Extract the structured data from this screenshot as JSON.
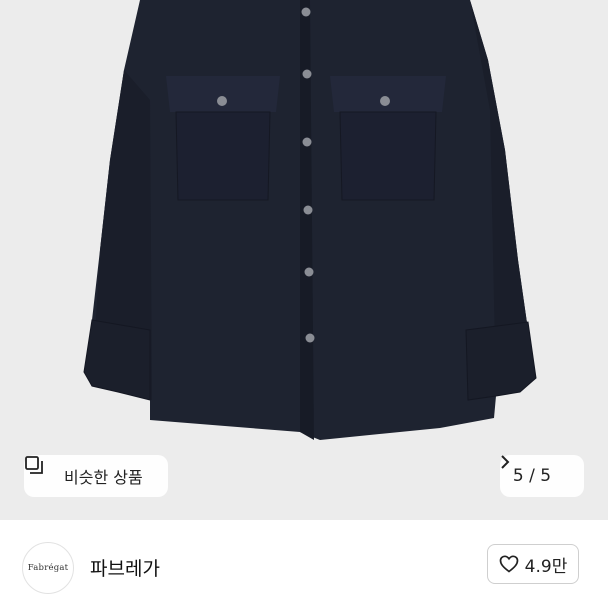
{
  "product": {
    "image_description": "navy button-up shirt with chest flap pockets",
    "shirt_color": "#1e2330",
    "background_color": "#ececec"
  },
  "similar_products": {
    "label": "비슷한 상품",
    "icon": "similar-items-icon"
  },
  "pager": {
    "label": "5 / 5",
    "current": 5,
    "total": 5,
    "icon": "chevron-right-icon"
  },
  "seller": {
    "logo_text": "Fabrégat",
    "name": "파브레가"
  },
  "likes": {
    "count_label": "4.9만",
    "icon": "heart-icon"
  }
}
